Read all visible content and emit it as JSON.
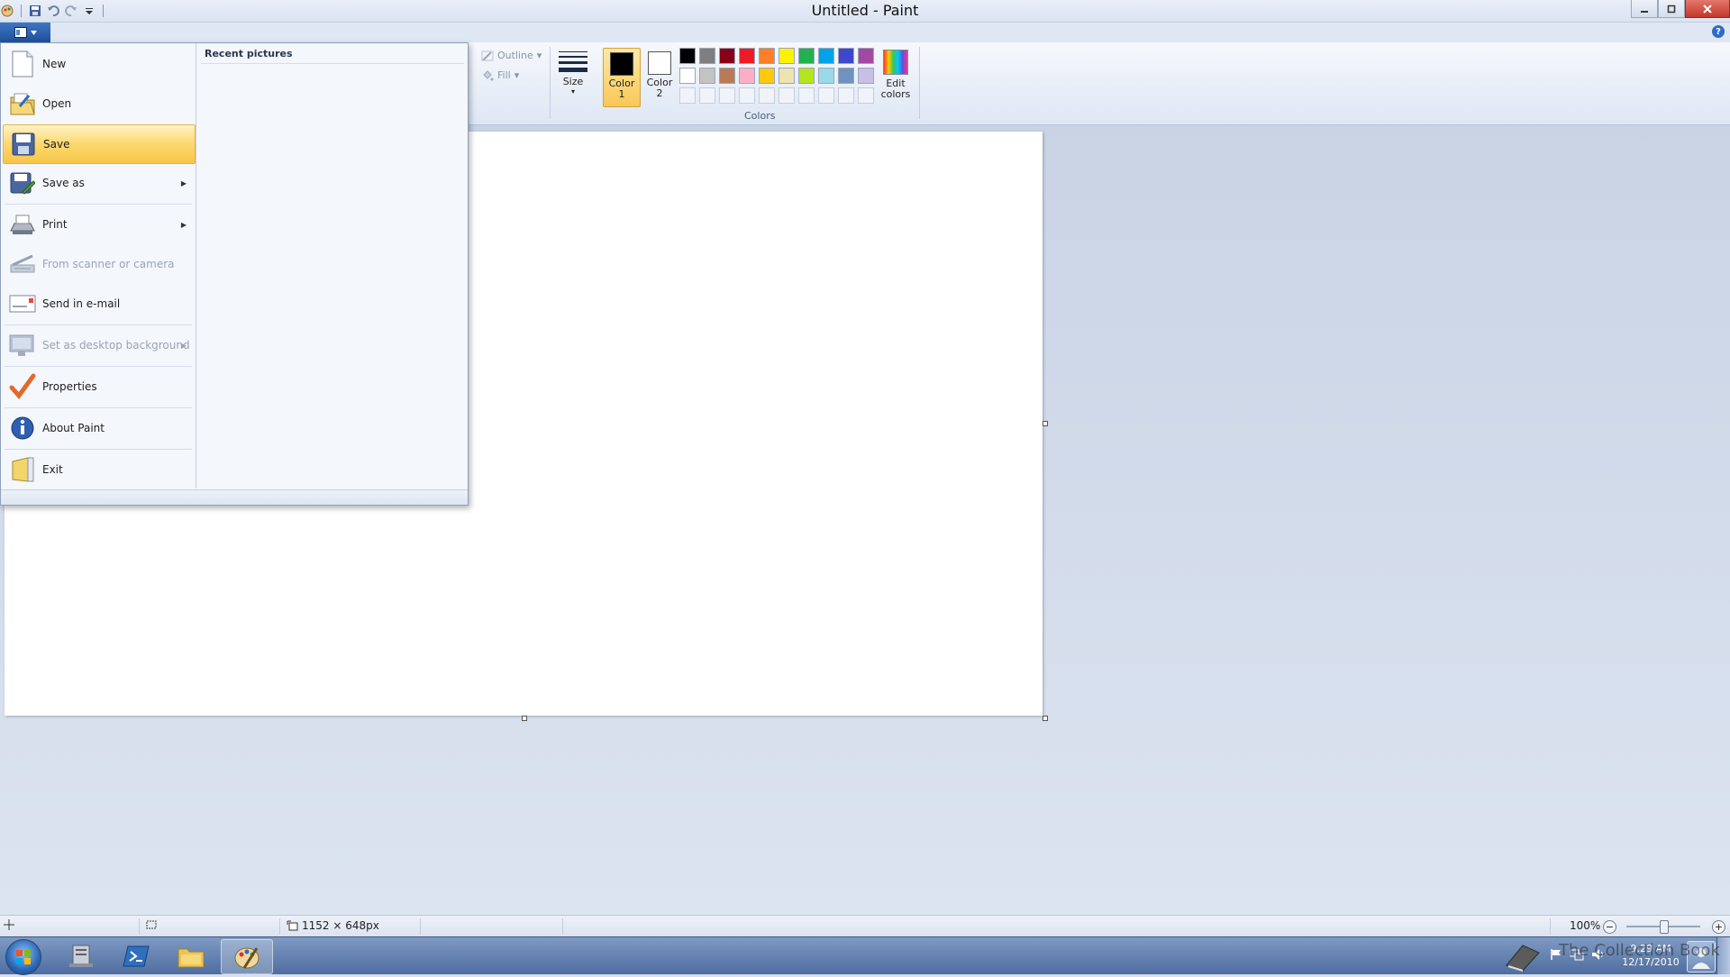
{
  "window": {
    "title": "Untitled - Paint"
  },
  "ribbon": {
    "outline_label": "Outline",
    "fill_label": "Fill",
    "size_label": "Size",
    "color1_label": "Color\n1",
    "color2_label": "Color\n2",
    "edit_colors_label": "Edit\ncolors",
    "colors_group_label": "Colors",
    "color1_value": "#000000",
    "color2_value": "#ffffff",
    "palette": [
      "#000000",
      "#7f7f7f",
      "#880015",
      "#ed1c24",
      "#ff7f27",
      "#fff200",
      "#22b14c",
      "#00a2e8",
      "#3f48cc",
      "#a349a4",
      "#ffffff",
      "#c3c3c3",
      "#b97a57",
      "#ffaec9",
      "#ffc90e",
      "#efe4b0",
      "#b5e61d",
      "#99d9ea",
      "#7092be",
      "#c8bfe7"
    ]
  },
  "file_menu": {
    "items": [
      {
        "label": "New",
        "icon": "new-document-icon",
        "disabled": false,
        "submenu": false
      },
      {
        "label": "Open",
        "icon": "open-folder-icon",
        "disabled": false,
        "submenu": false
      },
      {
        "label": "Save",
        "icon": "save-disk-icon",
        "disabled": false,
        "submenu": false,
        "highlighted": true
      },
      {
        "label": "Save as",
        "icon": "save-as-icon",
        "disabled": false,
        "submenu": true
      },
      {
        "label": "Print",
        "icon": "printer-icon",
        "disabled": false,
        "submenu": true
      },
      {
        "label": "From scanner or camera",
        "icon": "scanner-icon",
        "disabled": true,
        "submenu": false
      },
      {
        "label": "Send in e-mail",
        "icon": "email-icon",
        "disabled": false,
        "submenu": false
      },
      {
        "label": "Set as desktop background",
        "icon": "desktop-background-icon",
        "disabled": true,
        "submenu": true
      },
      {
        "label": "Properties",
        "icon": "checkmark-icon",
        "disabled": false,
        "submenu": false
      },
      {
        "label": "About Paint",
        "icon": "info-icon",
        "disabled": false,
        "submenu": false
      },
      {
        "label": "Exit",
        "icon": "exit-icon",
        "disabled": false,
        "submenu": false
      }
    ],
    "recent_title": "Recent pictures"
  },
  "status": {
    "canvas_size": "1152 × 648px",
    "zoom": "100%"
  },
  "taskbar": {
    "time": "9:29 AM",
    "date": "12/17/2010",
    "watermark": "The Collection Book"
  }
}
